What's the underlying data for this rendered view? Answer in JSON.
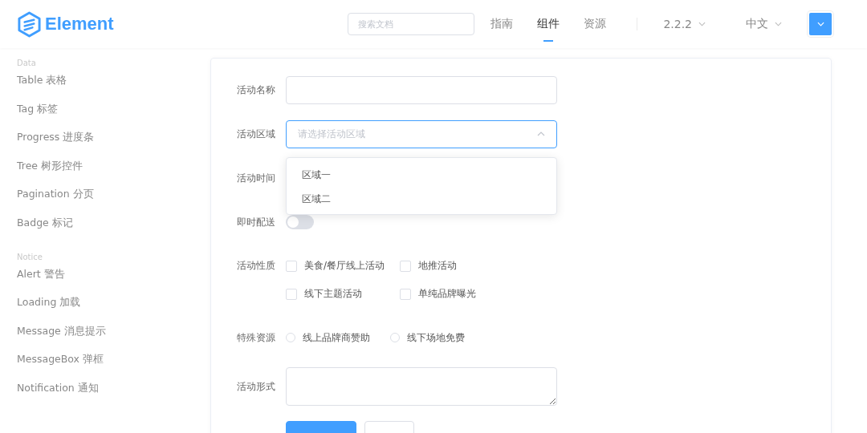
{
  "header": {
    "logo": "Element",
    "search": {
      "placeholder": "搜索文档"
    },
    "nav": [
      {
        "label": "指南",
        "selected": false
      },
      {
        "label": "组件",
        "selected": true
      },
      {
        "label": "资源",
        "selected": false
      }
    ],
    "version": "2.2.2",
    "language": "中文"
  },
  "sidebar": {
    "groups": [
      {
        "title": "Data",
        "items": [
          "Table 表格",
          "Tag 标签",
          "Progress 进度条",
          "Tree 树形控件",
          "Pagination 分页",
          "Badge 标记"
        ]
      },
      {
        "title": "Notice",
        "items": [
          "Alert 警告",
          "Loading 加载",
          "Message 消息提示",
          "MessageBox 弹框",
          "Notification 通知"
        ]
      }
    ]
  },
  "form": {
    "rows": [
      {
        "kind": "input",
        "label": "活动名称"
      },
      {
        "kind": "select",
        "label": "活动区域",
        "placeholder": "请选择活动区域",
        "expanded": true,
        "options": [
          "区域一",
          "区域二"
        ]
      },
      {
        "kind": "covered",
        "label": "活动时间"
      },
      {
        "kind": "switch",
        "label": "即时配送",
        "on": false
      },
      {
        "kind": "checkboxes",
        "label": "活动性质",
        "options": [
          {
            "label": "美食/餐厅线上活动",
            "checked": false
          },
          {
            "label": "地推活动",
            "checked": false
          },
          {
            "label": "线下主题活动",
            "checked": false
          },
          {
            "label": "单纯品牌曝光",
            "checked": false
          }
        ]
      },
      {
        "kind": "radios",
        "label": "特殊资源",
        "options": [
          {
            "label": "线上品牌商赞助",
            "selected": false
          },
          {
            "label": "线下场地免费",
            "selected": false
          }
        ]
      },
      {
        "kind": "textarea",
        "label": "活动形式"
      }
    ],
    "buttons": [
      {
        "kind": "primary"
      },
      {
        "kind": "default"
      }
    ]
  }
}
